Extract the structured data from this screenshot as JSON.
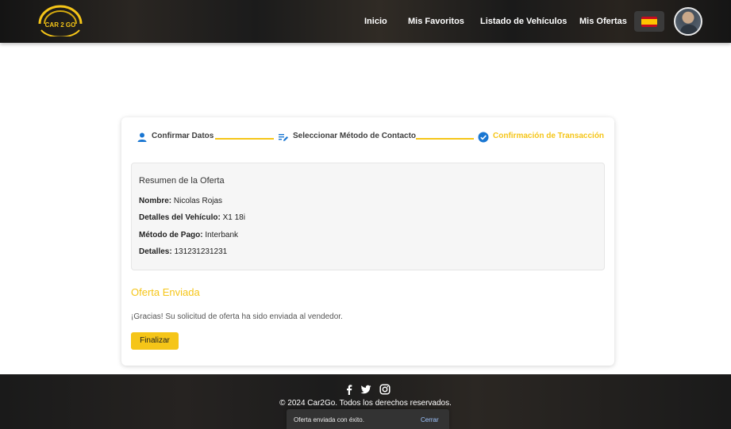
{
  "header": {
    "logo_text": "CAR 2 GO",
    "nav": [
      "Inicio",
      "Mis Favoritos",
      "Listado de Vehículos",
      "Mis Ofertas"
    ],
    "language": "es-flag-icon"
  },
  "stepper": {
    "steps": [
      {
        "label": "Confirmar Datos",
        "icon": "person-icon"
      },
      {
        "label": "Seleccionar Método de Contacto",
        "icon": "edit-list-icon"
      },
      {
        "label": "Confirmación de Transacción",
        "icon": "check-circle-icon"
      }
    ]
  },
  "summary": {
    "title": "Resumen de la Oferta",
    "rows": [
      {
        "label": "Nombre:",
        "value": "Nicolas Rojas"
      },
      {
        "label": "Detalles del Vehículo:",
        "value": "X1 18i"
      },
      {
        "label": "Método de Pago:",
        "value": "Interbank"
      },
      {
        "label": "Detalles:",
        "value": "131231231231"
      }
    ]
  },
  "result": {
    "title": "Oferta Enviada",
    "message": "¡Gracias! Su solicitud de oferta ha sido enviada al vendedor.",
    "button": "Finalizar"
  },
  "footer": {
    "social": [
      "facebook-icon",
      "twitter-icon",
      "instagram-icon"
    ],
    "copyright": "© 2024 Car2Go. Todos los derechos reservados."
  },
  "toast": {
    "message": "Oferta enviada con éxito.",
    "action": "Cerrar"
  },
  "colors": {
    "accent": "#f5c518",
    "step_icon_blue": "#1976d2"
  }
}
